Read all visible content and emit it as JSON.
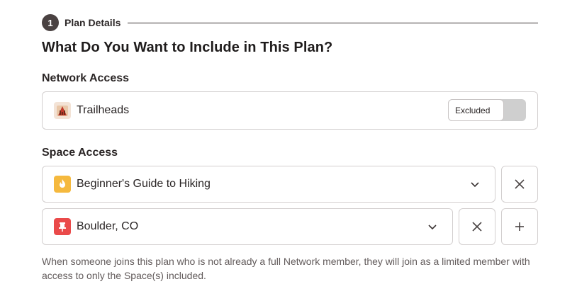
{
  "step": {
    "number": "1",
    "label": "Plan Details"
  },
  "title": "What Do You Want to Include in This Plan?",
  "network": {
    "section_label": "Network Access",
    "item": {
      "name": "Trailheads",
      "icon": "trailheads-icon"
    },
    "toggle": {
      "label": "Excluded",
      "state": "excluded"
    }
  },
  "spaces": {
    "section_label": "Space Access",
    "items": [
      {
        "name": "Beginner's Guide to Hiking",
        "icon": "fire-icon",
        "color": "#f5b93e"
      },
      {
        "name": "Boulder, CO",
        "icon": "pushpin-icon",
        "color": "#ea4a4a"
      }
    ]
  },
  "help_text": "When someone joins this plan who is not already a full Network member, they will join as a limited member with access to only the Space(s) included."
}
